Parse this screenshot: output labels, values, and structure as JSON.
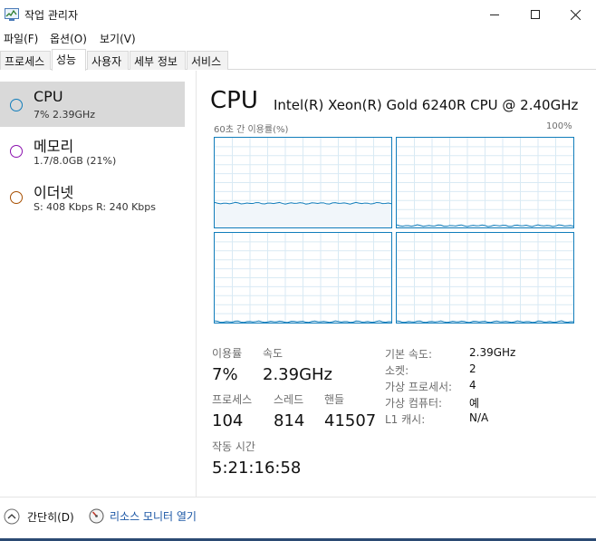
{
  "window": {
    "title": "작업 관리자",
    "controls": [
      "minimize",
      "maximize",
      "close"
    ]
  },
  "menu": {
    "items": [
      "파일(F)",
      "옵션(O)",
      "보기(V)"
    ]
  },
  "tabs": {
    "items": [
      "프로세스",
      "성능",
      "사용자",
      "세부 정보",
      "서비스"
    ],
    "active": "성능"
  },
  "sidebar": {
    "items": [
      {
        "name": "CPU",
        "sub": "7%  2.39GHz",
        "color": "#117dbb",
        "selected": true
      },
      {
        "name": "메모리",
        "sub": "1.7/8.0GB (21%)",
        "color": "#8b12ae",
        "selected": false
      },
      {
        "name": "이더넷",
        "sub": "S: 408 Kbps  R: 240 Kbps",
        "color": "#a74f01",
        "selected": false
      }
    ]
  },
  "main": {
    "title": "CPU",
    "model": "Intel(R) Xeon(R) Gold 6240R CPU @ 2.40GHz",
    "graph_caption": "60초 간 이용률(%)",
    "graph_max": "100%",
    "graphs": [
      {
        "label": "core-0",
        "utilization_percent": 27
      },
      {
        "label": "core-1",
        "utilization_percent": 2
      },
      {
        "label": "core-2",
        "utilization_percent": 1
      },
      {
        "label": "core-3",
        "utilization_percent": 1
      }
    ],
    "stats": {
      "utilization_label": "이용률",
      "utilization_value": "7%",
      "speed_label": "속도",
      "speed_value": "2.39GHz",
      "processes_label": "프로세스",
      "processes_value": "104",
      "threads_label": "스레드",
      "threads_value": "814",
      "handles_label": "핸들",
      "handles_value": "41507",
      "uptime_label": "작동 시간",
      "uptime_value": "5:21:16:58"
    },
    "specs": [
      {
        "label": "기본 속도:",
        "value": "2.39GHz"
      },
      {
        "label": "소켓:",
        "value": "2"
      },
      {
        "label": "가상 프로세서:",
        "value": "4"
      },
      {
        "label": "가상 컴퓨터:",
        "value": "예"
      },
      {
        "label": "L1 캐시:",
        "value": "N/A"
      }
    ]
  },
  "footer": {
    "collapse_label": "간단히(D)",
    "resource_monitor_label": "리소스 모니터 열기"
  },
  "colors": {
    "cpu_accent": "#117dbb",
    "graph_grid": "#d9eaf4",
    "graph_fill": "#f1f6fa",
    "selected_bg": "#d9d9d9"
  }
}
